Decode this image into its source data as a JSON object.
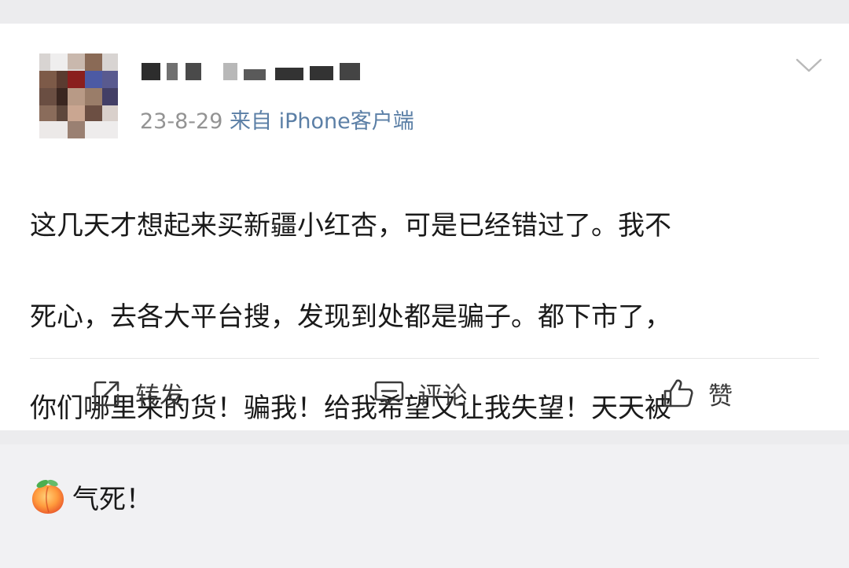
{
  "post": {
    "username_blurred": true,
    "date": "23-8-29",
    "source": "来自 iPhone客户端",
    "content_lines": [
      "这几天才想起来买新疆小红杏，可是已经错过了。我不",
      "死心，去各大平台搜，发现到处都是骗子。都下市了，",
      "你们哪里来的货！骗我！给我希望又让我失望！天天被",
      "气死！"
    ],
    "emoji": "peach-emoji"
  },
  "actions": {
    "repost_label": "转发",
    "comment_label": "评论",
    "like_label": "赞"
  },
  "icons": {
    "more": "chevron-down-icon",
    "repost": "repost-icon",
    "comment": "comment-icon",
    "like": "thumbs-up-icon"
  },
  "colors": {
    "source_link": "#5b7fa6",
    "meta_text": "#939393",
    "body_text": "#1a1a1a"
  }
}
